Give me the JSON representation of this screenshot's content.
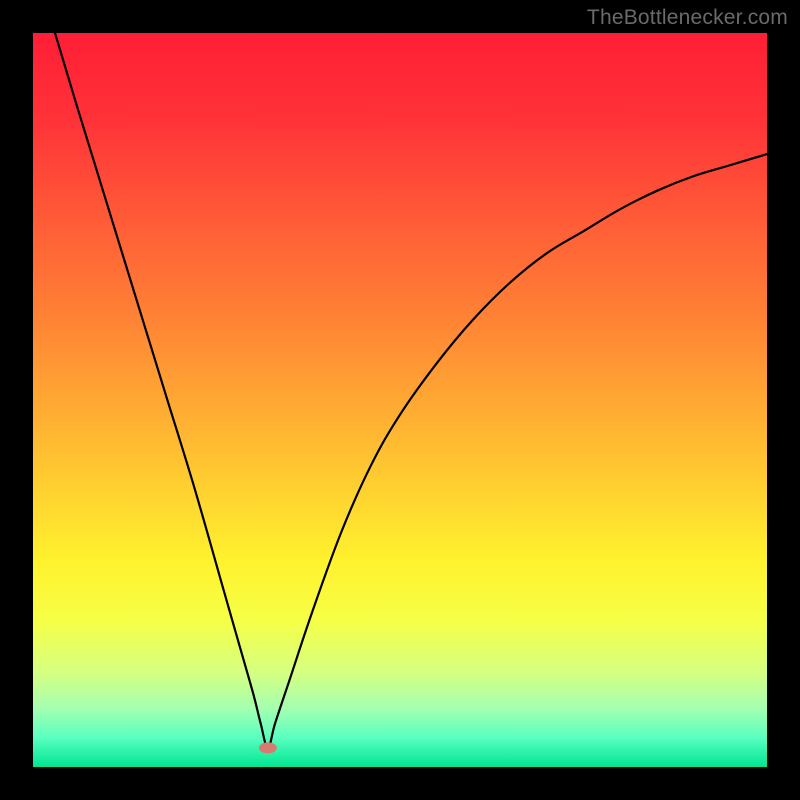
{
  "attribution": "TheBottlenecker.com",
  "colors": {
    "frame": "#000000",
    "curve": "#000000",
    "marker_fill": "#d87a6e",
    "gradient_stops": [
      {
        "offset": 0.0,
        "color": "#ff1e36"
      },
      {
        "offset": 0.12,
        "color": "#ff3338"
      },
      {
        "offset": 0.25,
        "color": "#ff5a37"
      },
      {
        "offset": 0.38,
        "color": "#ff8035"
      },
      {
        "offset": 0.5,
        "color": "#ffa733"
      },
      {
        "offset": 0.62,
        "color": "#ffd030"
      },
      {
        "offset": 0.72,
        "color": "#fff22e"
      },
      {
        "offset": 0.8,
        "color": "#f6ff46"
      },
      {
        "offset": 0.87,
        "color": "#d6ff80"
      },
      {
        "offset": 0.92,
        "color": "#a4ffb0"
      },
      {
        "offset": 0.96,
        "color": "#59ffc0"
      },
      {
        "offset": 1.0,
        "color": "#00e692"
      }
    ]
  },
  "chart_data": {
    "type": "line",
    "title": "",
    "xlabel": "",
    "ylabel": "",
    "xlim": [
      0,
      100
    ],
    "ylim": [
      0,
      100
    ],
    "grid": false,
    "legend": false,
    "marker": {
      "x": 32,
      "y": 2.6
    },
    "series": [
      {
        "name": "curve",
        "x": [
          3,
          6,
          10,
          14,
          18,
          22,
          26,
          28,
          30,
          31,
          32,
          33,
          35,
          38,
          42,
          46,
          50,
          55,
          60,
          65,
          70,
          75,
          80,
          85,
          90,
          95,
          100
        ],
        "y": [
          100,
          90,
          77,
          64,
          51,
          38,
          24,
          17,
          10,
          6,
          2.6,
          6,
          12,
          21,
          32,
          41,
          48,
          55,
          61,
          66,
          70,
          73,
          76,
          78.5,
          80.5,
          82,
          83.5
        ]
      }
    ]
  }
}
